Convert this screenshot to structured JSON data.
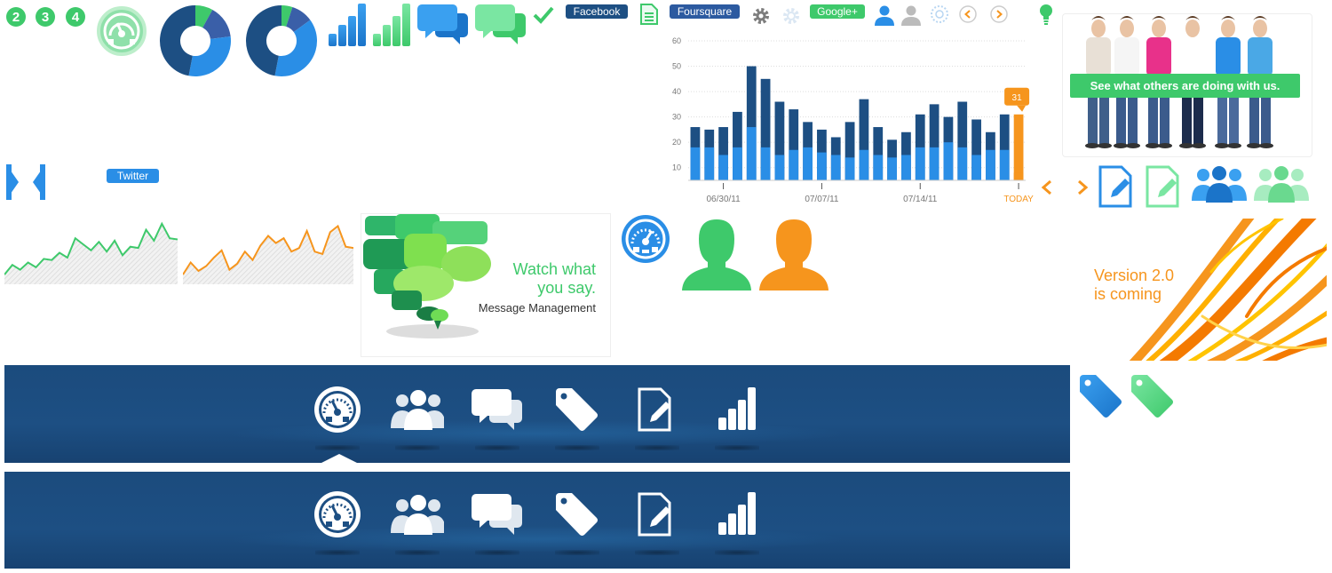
{
  "badges": [
    "2",
    "3",
    "4"
  ],
  "pills": {
    "facebook": "Facebook",
    "foursquare": "Foursquare",
    "google": "Google+",
    "twitter": "Twitter"
  },
  "colors": {
    "green": "#3ec96b",
    "blue": "#2a8ee6",
    "navy": "#1d4f83",
    "orange": "#f6951d",
    "facebook": "#1d4f83",
    "foursquare": "#2c5aa0",
    "twitter": "#2a8ee6"
  },
  "donuts": [
    {
      "segments": [
        0.08,
        0.15,
        0.3,
        0.47
      ]
    },
    {
      "segments": [
        0.05,
        0.1,
        0.38,
        0.47
      ]
    }
  ],
  "promo1": {
    "headline_line1": "Watch what",
    "headline_line2": "you say.",
    "subtitle": "Message Management"
  },
  "promo2": {
    "line1": "Version 2.0",
    "line2": "is coming"
  },
  "people_banner": {
    "caption": "See what others are doing with us."
  },
  "chart_data": {
    "type": "bar",
    "title": "",
    "xlabel": "",
    "ylabel": "",
    "ylim": [
      5,
      60
    ],
    "yticks": [
      10,
      20,
      30,
      40,
      50,
      60
    ],
    "x_tick_labels": [
      "06/30/11",
      "07/07/11",
      "07/14/11",
      "TODAY"
    ],
    "x_tick_positions": [
      2,
      9,
      16,
      23
    ],
    "callout": {
      "index": 23,
      "label": "31"
    },
    "series": [
      {
        "values": [
          26,
          25,
          26,
          32,
          50,
          45,
          36,
          33,
          28,
          25,
          22,
          28,
          37,
          26,
          21,
          24,
          31,
          35,
          30,
          36,
          29,
          24,
          31,
          31
        ]
      },
      {
        "values": [
          18,
          18,
          15,
          18,
          26,
          18,
          15,
          17,
          18,
          16,
          15,
          14,
          17,
          15,
          14,
          15,
          18,
          18,
          20,
          18,
          15,
          17,
          17,
          8
        ]
      }
    ]
  },
  "sparklines": [
    {
      "values": [
        8,
        16,
        12,
        18,
        14,
        21,
        20,
        26,
        22,
        38,
        33,
        28,
        35,
        27,
        36,
        24,
        31,
        30,
        45,
        36,
        50,
        38,
        37
      ]
    },
    {
      "values": [
        8,
        18,
        11,
        15,
        22,
        28,
        12,
        17,
        27,
        20,
        32,
        40,
        34,
        38,
        27,
        30,
        44,
        27,
        25,
        43,
        48,
        31,
        30
      ]
    }
  ]
}
